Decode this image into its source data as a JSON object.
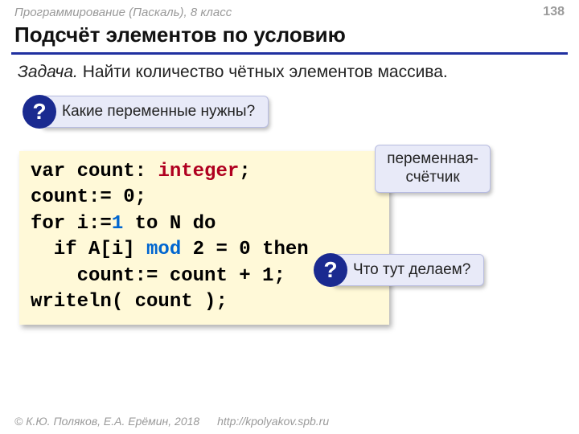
{
  "header": {
    "course": "Программирование (Паскаль), 8 класс",
    "page": "138"
  },
  "title": "Подсчёт элементов по условию",
  "task": {
    "label": "Задача.",
    "text": "Найти количество чётных элементов массива."
  },
  "callouts": {
    "q1": "Какие переменные нужны?",
    "tag1_l1": "переменная-",
    "tag1_l2": "счётчик",
    "q2": "Что тут делаем?"
  },
  "code": {
    "l1_a": "var count: ",
    "l1_b": "integer",
    "l1_c": ";",
    "l2": "count:= 0;",
    "l3_a": "for i:=",
    "l3_b": "1",
    "l3_c": " to N do",
    "l4_a": "  if A[i] ",
    "l4_b": "mod",
    "l4_c": " 2 = 0 then",
    "l5": "    count:= count + 1;",
    "l6": "writeln( count );"
  },
  "footer": {
    "copyright": "© К.Ю. Поляков, Е.А. Ерёмин, 2018",
    "url": "http://kpolyakov.spb.ru"
  }
}
